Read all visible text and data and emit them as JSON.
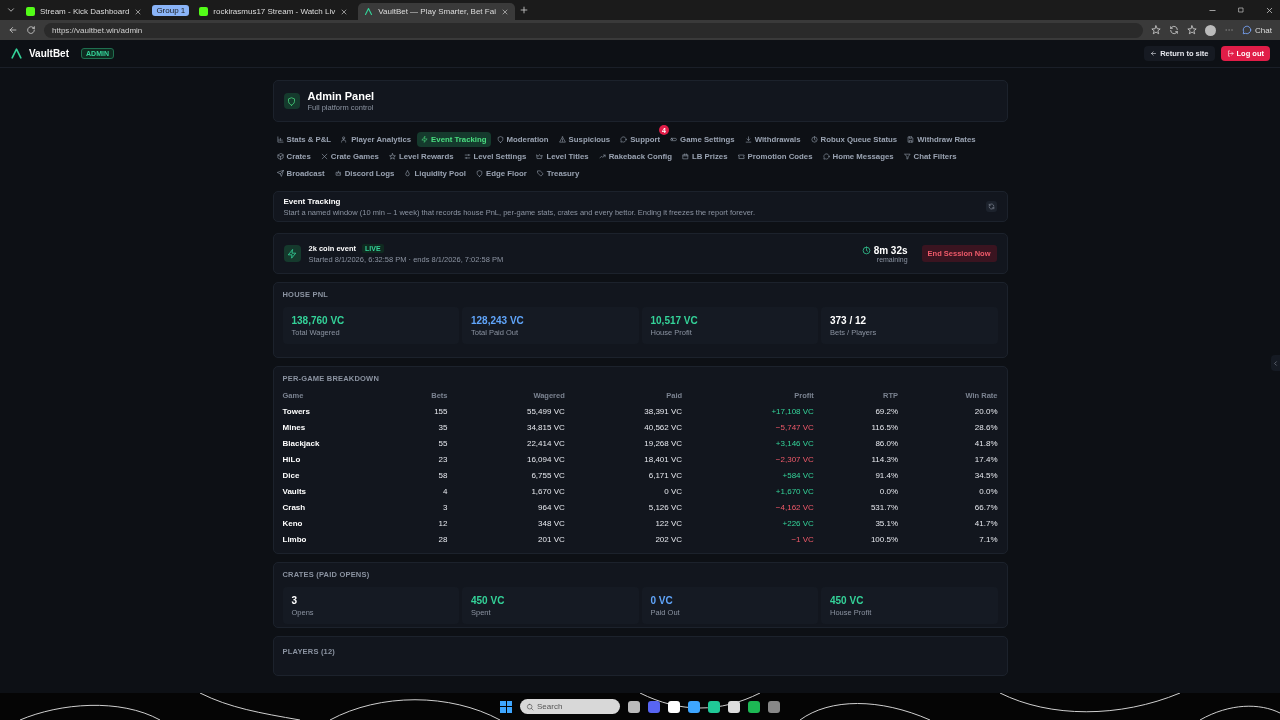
{
  "browser": {
    "tabs": [
      {
        "title": "Stream - Kick Dashboard",
        "selected": false
      },
      {
        "title": "rockirasmus17 Stream - Watch Liv",
        "selected": false
      },
      {
        "title": "VaultBet — Play Smarter, Bet Fai",
        "selected": true
      }
    ],
    "group_label": "Group 1",
    "address": "https://vaultbet.win/admin",
    "chat_label": "Chat"
  },
  "header": {
    "brand": "VaultBet",
    "badge": "ADMIN",
    "return_label": "Return to site",
    "logout_label": "Log out"
  },
  "panel": {
    "title": "Admin Panel",
    "subtitle": "Full platform control"
  },
  "nav": [
    {
      "label": "Stats & P&L",
      "selected": false
    },
    {
      "label": "Player Analytics",
      "selected": false
    },
    {
      "label": "Event Tracking",
      "selected": true
    },
    {
      "label": "Moderation",
      "selected": false
    },
    {
      "label": "Suspicious",
      "selected": false
    },
    {
      "label": "Support",
      "selected": false,
      "badge": "4"
    },
    {
      "label": "Game Settings",
      "selected": false
    },
    {
      "label": "Withdrawals",
      "selected": false
    },
    {
      "label": "Robux Queue Status",
      "selected": false
    },
    {
      "label": "Withdraw Rates",
      "selected": false
    },
    {
      "label": "Crates",
      "selected": false
    },
    {
      "label": "Crate Games",
      "selected": false
    },
    {
      "label": "Level Rewards",
      "selected": false
    },
    {
      "label": "Level Settings",
      "selected": false
    },
    {
      "label": "Level Titles",
      "selected": false
    },
    {
      "label": "Rakeback Config",
      "selected": false
    },
    {
      "label": "LB Prizes",
      "selected": false
    },
    {
      "label": "Promotion Codes",
      "selected": false
    },
    {
      "label": "Home Messages",
      "selected": false
    },
    {
      "label": "Chat Filters",
      "selected": false
    },
    {
      "label": "Broadcast",
      "selected": false
    },
    {
      "label": "Discord Logs",
      "selected": false
    },
    {
      "label": "Liquidity Pool",
      "selected": false
    },
    {
      "label": "Edge Floor",
      "selected": false
    },
    {
      "label": "Treasury",
      "selected": false
    }
  ],
  "event_tracking": {
    "title": "Event Tracking",
    "description": "Start a named window (10 min – 1 week) that records house PnL, per-game stats, crates and every bettor. Ending it freezes the report forever."
  },
  "session": {
    "name": "2k coin event",
    "status": "LIVE",
    "times": "Started 8/1/2026, 6:32:58 PM · ends 8/1/2026, 7:02:58 PM",
    "countdown": "8m 32s",
    "countdown_label": "remaining",
    "end_label": "End Session Now"
  },
  "house_pnl": {
    "title": "HOUSE PNL",
    "stats": [
      {
        "value": "138,760 VC",
        "label": "Total Wagered",
        "color": "#34d399"
      },
      {
        "value": "128,243 VC",
        "label": "Total Paid Out",
        "color": "#60a5fa"
      },
      {
        "value": "10,517 VC",
        "label": "House Profit",
        "color": "#34d399"
      },
      {
        "value": "373 / 12",
        "label": "Bets / Players",
        "color": "#ffffff"
      }
    ]
  },
  "breakdown": {
    "title": "PER-GAME BREAKDOWN",
    "columns": [
      "Game",
      "Bets",
      "Wagered",
      "Paid",
      "Profit",
      "RTP",
      "Win Rate"
    ],
    "rows": [
      {
        "cells": [
          "Towers",
          "155",
          "55,499 VC",
          "38,391 VC",
          "+17,108 VC",
          "69.2%",
          "20.0%"
        ],
        "profit_positive": true
      },
      {
        "cells": [
          "Mines",
          "35",
          "34,815 VC",
          "40,562 VC",
          "−5,747 VC",
          "116.5%",
          "28.6%"
        ],
        "profit_positive": false
      },
      {
        "cells": [
          "Blackjack",
          "55",
          "22,414 VC",
          "19,268 VC",
          "+3,146 VC",
          "86.0%",
          "41.8%"
        ],
        "profit_positive": true
      },
      {
        "cells": [
          "HiLo",
          "23",
          "16,094 VC",
          "18,401 VC",
          "−2,307 VC",
          "114.3%",
          "17.4%"
        ],
        "profit_positive": false
      },
      {
        "cells": [
          "Dice",
          "58",
          "6,755 VC",
          "6,171 VC",
          "+584 VC",
          "91.4%",
          "34.5%"
        ],
        "profit_positive": true
      },
      {
        "cells": [
          "Vaults",
          "4",
          "1,670 VC",
          "0 VC",
          "+1,670 VC",
          "0.0%",
          "0.0%"
        ],
        "profit_positive": true
      },
      {
        "cells": [
          "Crash",
          "3",
          "964 VC",
          "5,126 VC",
          "−4,162 VC",
          "531.7%",
          "66.7%"
        ],
        "profit_positive": false
      },
      {
        "cells": [
          "Keno",
          "12",
          "348 VC",
          "122 VC",
          "+226 VC",
          "35.1%",
          "41.7%"
        ],
        "profit_positive": true
      },
      {
        "cells": [
          "Limbo",
          "28",
          "201 VC",
          "202 VC",
          "−1 VC",
          "100.5%",
          "7.1%"
        ],
        "profit_positive": false
      }
    ]
  },
  "crates": {
    "title": "CRATES (PAID OPENS)",
    "stats": [
      {
        "value": "3",
        "label": "Opens",
        "color": "#ffffff"
      },
      {
        "value": "450 VC",
        "label": "Spent",
        "color": "#34d399"
      },
      {
        "value": "0 VC",
        "label": "Paid Out",
        "color": "#60a5fa"
      },
      {
        "value": "450 VC",
        "label": "House Profit",
        "color": "#34d399"
      }
    ]
  },
  "players": {
    "title": "PLAYERS (12)"
  },
  "taskbar": {
    "search_placeholder": "Search"
  }
}
